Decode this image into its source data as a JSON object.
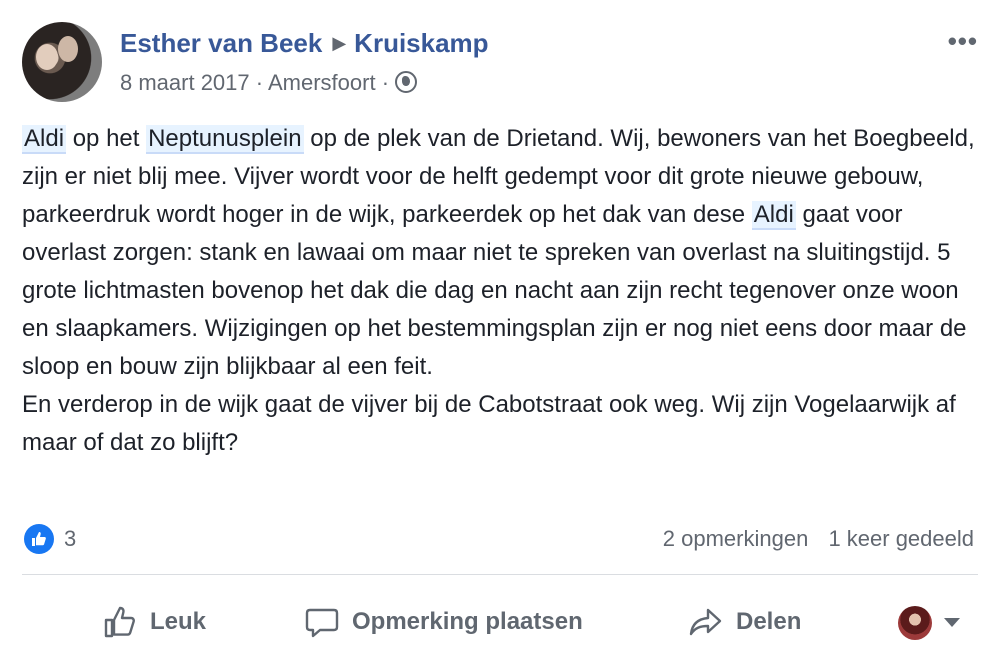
{
  "post": {
    "author": "Esther van Beek",
    "group": "Kruiskamp",
    "date": "8 maart 2017",
    "location": "Amersfoort",
    "separator": "·",
    "more_label": "•••",
    "body": {
      "line1_tag1": "Aldi",
      "line1_a": " op het ",
      "line1_tag2": "Neptunusplein",
      "line1_b": " op de plek van de Drietand. Wij, bewoners van het Boegbeeld, zijn er niet blij mee. Vijver wordt voor de helft gedempt voor dit grote nieuwe gebouw, parkeerdruk wordt hoger in de wijk, parkeerdek op het dak van dese ",
      "line1_tag3": "Aldi",
      "line1_c": " gaat voor overlast zorgen: stank en lawaai om maar niet te spreken van overlast na sluitingstijd. 5 grote lichtmasten bovenop het dak die dag en nacht aan zijn recht tegenover onze woon en slaapkamers. Wijzigingen op het bestemmingsplan zijn er nog niet eens door maar de sloop en bouw zijn blijkbaar al een feit.",
      "paragraph2": "En verderop in de wijk gaat de vijver bij de Cabotstraat ook weg. Wij zijn Vogelaarwijk af maar of dat zo blijft?"
    }
  },
  "stats": {
    "likes": "3",
    "comments": "2 opmerkingen",
    "shares": "1 keer gedeeld"
  },
  "actions": {
    "like": "Leuk",
    "comment": "Opmerking plaatsen",
    "share": "Delen"
  },
  "colors": {
    "link": "#385898",
    "secondary": "#616770",
    "like_blue": "#1877f2",
    "tag_bg": "#e7f3ff"
  }
}
